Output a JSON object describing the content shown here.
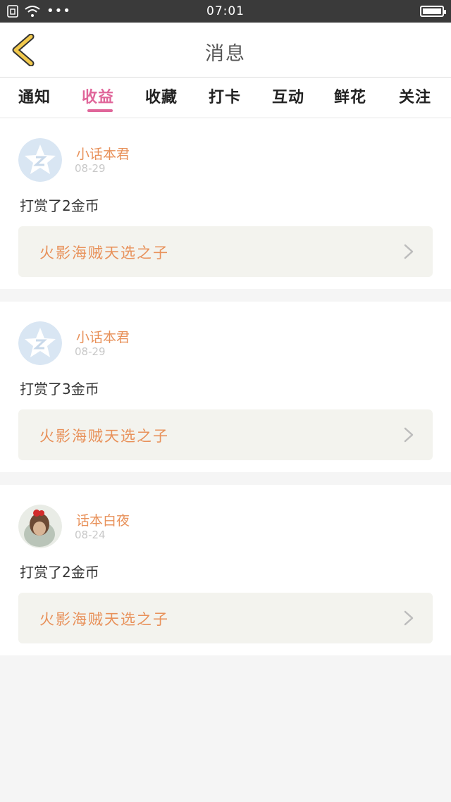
{
  "status": {
    "time": "07:01",
    "icons": [
      "sim-icon",
      "wifi-icon",
      "more-dots-icon",
      "battery-icon"
    ]
  },
  "header": {
    "title": "消息",
    "back_icon": "back-chevron-icon",
    "accent": "#f2c94c"
  },
  "tabs": [
    {
      "label": "通知"
    },
    {
      "label": "收益"
    },
    {
      "label": "收藏"
    },
    {
      "label": "打卡"
    },
    {
      "label": "互动"
    },
    {
      "label": "鲜花"
    },
    {
      "label": "关注"
    }
  ],
  "active_tab": "收益",
  "colors": {
    "active_tab": "#e0669a",
    "username": "#e8915a",
    "link_text": "#e8915a"
  },
  "messages": [
    {
      "user": "小话本君",
      "date": "08-29",
      "text": "打赏了2金币",
      "link": "火影海贼天选之子",
      "avatar": "default-star-avatar"
    },
    {
      "user": "小话本君",
      "date": "08-29",
      "text": "打赏了3金币",
      "link": "火影海贼天选之子",
      "avatar": "default-star-avatar"
    },
    {
      "user": "话本白夜",
      "date": "08-24",
      "text": "打赏了2金币",
      "link": "火影海贼天选之子",
      "avatar": "photo-avatar"
    }
  ]
}
